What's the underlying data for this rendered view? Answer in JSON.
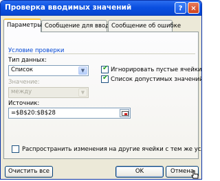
{
  "window": {
    "title": "Проверка вводимых значений",
    "help_icon": "?",
    "close_icon": "×"
  },
  "tabs": [
    {
      "label": "Параметры",
      "active": true
    },
    {
      "label": "Сообщение для ввода",
      "active": false
    },
    {
      "label": "Сообщение об ошибке",
      "active": false
    }
  ],
  "criteria": {
    "group_title": "Условие проверки",
    "data_type_label": "Тип данных:",
    "data_type_value": "Список",
    "value_label": "Значение:",
    "value_value": "между",
    "ignore_blank_label": "Игнорировать пустые ячейки",
    "ignore_blank_checked": true,
    "in_cell_dropdown_label": "Список допустимых значений",
    "in_cell_dropdown_checked": true,
    "source_label": "Источник:",
    "source_value": "=$B$20:$B$28"
  },
  "apply_all": {
    "label": "Распространить изменения на другие ячейки с тем же условием",
    "checked": false
  },
  "buttons": {
    "clear_all": "Очистить все",
    "ok": "OK",
    "cancel": "Отмена"
  },
  "colors": {
    "title_bar": "#0a4fe0",
    "group_title": "#0046d5",
    "check_mark": "#21a121",
    "active_tab_accent": "#ffc83c"
  }
}
